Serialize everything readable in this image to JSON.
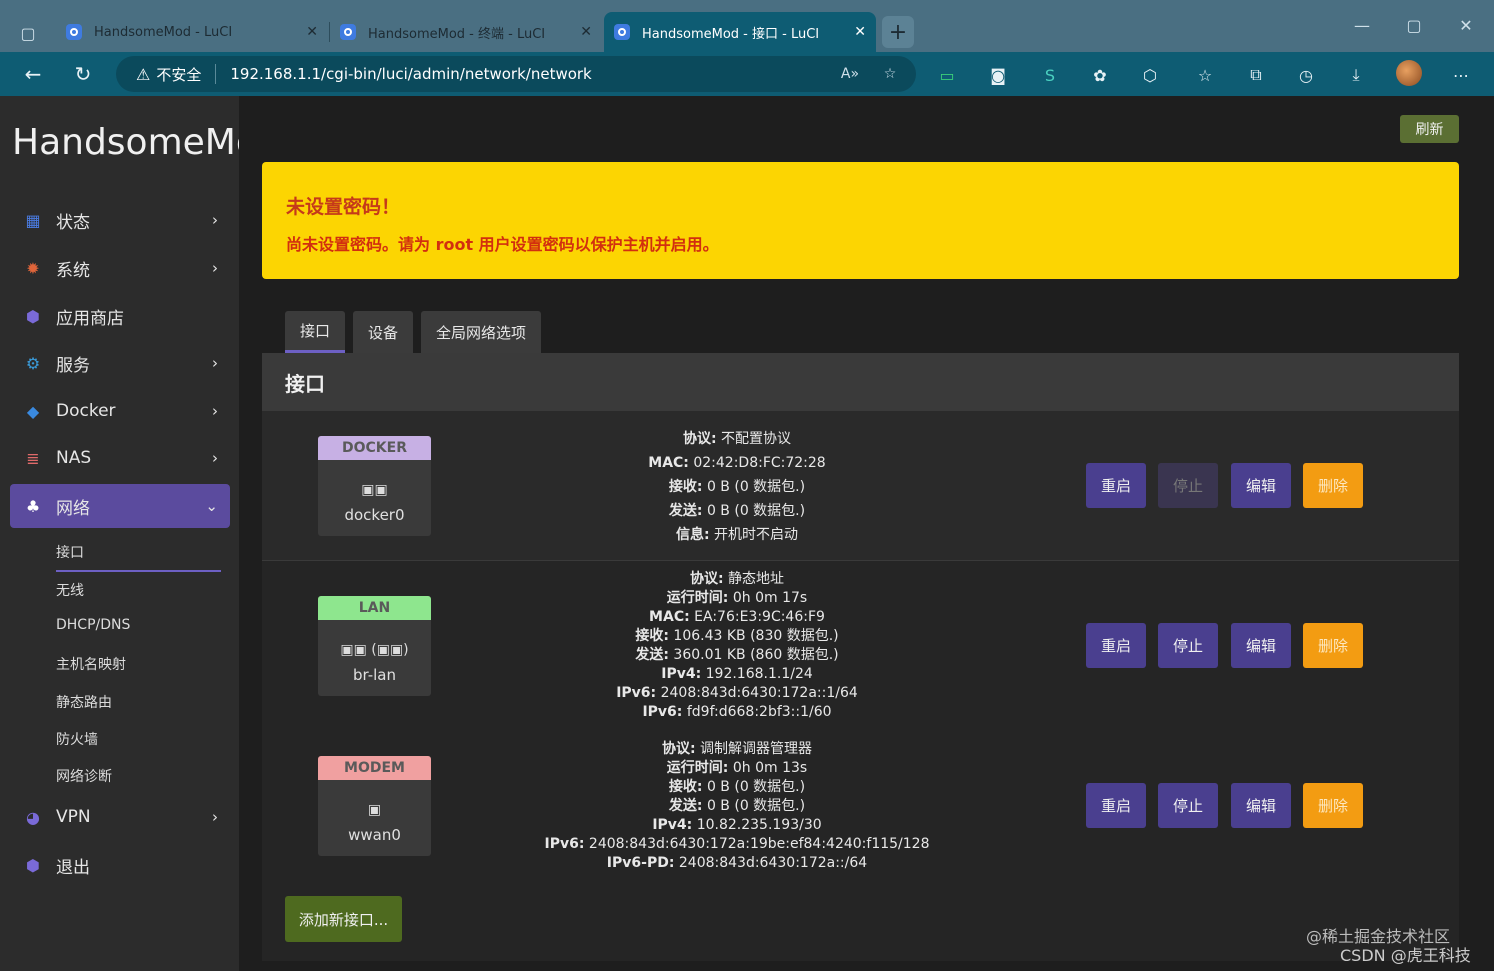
{
  "browser": {
    "tabs": [
      {
        "title": "HandsomeMod - LuCI",
        "active": false
      },
      {
        "title": "HandsomeMod - 终端 - LuCI",
        "active": false
      },
      {
        "title": "HandsomeMod - 接口 - LuCI",
        "active": true
      }
    ],
    "security_label": "不安全",
    "url": "192.168.1.1/cgi-bin/luci/admin/network/network"
  },
  "sidebar": {
    "brand": "HandsomeMod",
    "items": [
      {
        "label": "状态",
        "icon": "dashboard-icon",
        "has_chevron": true
      },
      {
        "label": "系统",
        "icon": "gear-icon",
        "has_chevron": true
      },
      {
        "label": "应用商店",
        "icon": "cube-icon",
        "has_chevron": false
      },
      {
        "label": "服务",
        "icon": "cogs-icon",
        "has_chevron": true
      },
      {
        "label": "Docker",
        "icon": "docker-icon",
        "has_chevron": true
      },
      {
        "label": "NAS",
        "icon": "database-icon",
        "has_chevron": true
      },
      {
        "label": "网络",
        "icon": "sitemap-icon",
        "has_chevron": true,
        "active": true
      },
      {
        "label": "VPN",
        "icon": "vpn-icon",
        "has_chevron": true
      },
      {
        "label": "退出",
        "icon": "logout-icon",
        "has_chevron": false
      }
    ],
    "network_submenu": [
      "接口",
      "无线",
      "DHCP/DNS",
      "主机名映射",
      "静态路由",
      "防火墙",
      "网络诊断"
    ]
  },
  "refresh_label": "刷新",
  "alert": {
    "title": "未设置密码！",
    "message": "尚未设置密码。请为 root 用户设置密码以保护主机并启用。"
  },
  "page_tabs": [
    "接口",
    "设备",
    "全局网络选项"
  ],
  "panel_title": "接口",
  "interfaces": [
    {
      "name": "DOCKER",
      "device": "docker0",
      "header_color": "#c7b0e4",
      "lines": [
        {
          "k": "协议:",
          "v": "不配置协议"
        },
        {
          "k": "MAC:",
          "v": "02:42:D8:FC:72:28"
        },
        {
          "k": "接收:",
          "v": "0 B (0 数据包.)"
        },
        {
          "k": "发送:",
          "v": "0 B (0 数据包.)"
        },
        {
          "k": "信息:",
          "v": "开机时不启动"
        }
      ],
      "stop_disabled": true
    },
    {
      "name": "LAN",
      "device": "br-lan",
      "header_color": "#8ee68e",
      "lines": [
        {
          "k": "协议:",
          "v": "静态地址"
        },
        {
          "k": "运行时间:",
          "v": "0h 0m 17s"
        },
        {
          "k": "MAC:",
          "v": "EA:76:E3:9C:46:F9"
        },
        {
          "k": "接收:",
          "v": "106.43 KB (830 数据包.)"
        },
        {
          "k": "发送:",
          "v": "360.01 KB (860 数据包.)"
        },
        {
          "k": "IPv4:",
          "v": "192.168.1.1/24"
        },
        {
          "k": "IPv6:",
          "v": "2408:843d:6430:172a::1/64"
        },
        {
          "k": "IPv6:",
          "v": "fd9f:d668:2bf3::1/60"
        }
      ],
      "stop_disabled": false
    },
    {
      "name": "MODEM",
      "device": "wwan0",
      "header_color": "#f0a0a0",
      "lines": [
        {
          "k": "协议:",
          "v": "调制解调器管理器"
        },
        {
          "k": "运行时间:",
          "v": "0h 0m 13s"
        },
        {
          "k": "接收:",
          "v": "0 B (0 数据包.)"
        },
        {
          "k": "发送:",
          "v": "0 B (0 数据包.)"
        },
        {
          "k": "IPv4:",
          "v": "10.82.235.193/30"
        },
        {
          "k": "IPv6:",
          "v": "2408:843d:6430:172a:19be:ef84:4240:f115/128"
        },
        {
          "k": "IPv6-PD:",
          "v": "2408:843d:6430:172a::/64"
        }
      ],
      "stop_disabled": false
    }
  ],
  "buttons": {
    "restart": "重启",
    "stop": "停止",
    "edit": "编辑",
    "delete": "删除"
  },
  "add_interface_label": "添加新接口...",
  "watermark": [
    "@稀土掘金技术社区",
    "CSDN @虎王科技"
  ]
}
